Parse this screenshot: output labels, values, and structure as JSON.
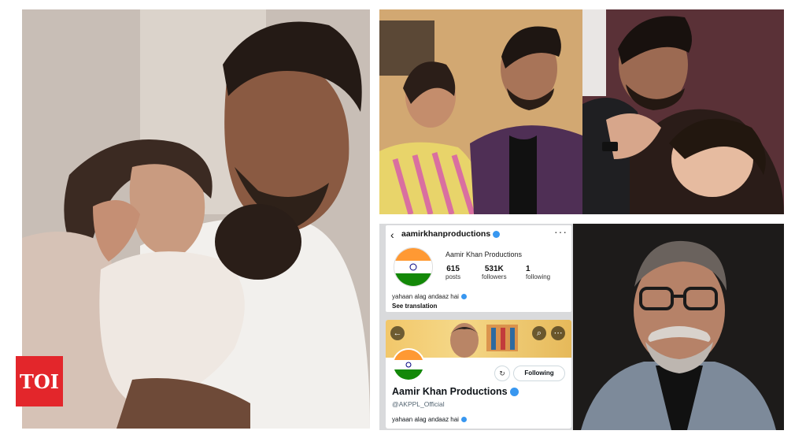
{
  "logo": {
    "text": "TOI"
  },
  "instagram": {
    "handle": "aamirkhanproductions",
    "more": "···",
    "display_name": "Aamir Khan Productions",
    "posts_count": "615",
    "posts_label": "posts",
    "followers_count": "531K",
    "followers_label": "followers",
    "following_count": "1",
    "following_label": "following",
    "bio": "yahaan alag andaaz hai",
    "see_translation": "See translation"
  },
  "twitter": {
    "follow_button": "Following",
    "display_name": "Aamir Khan Productions",
    "handle": "@AKPPL_Official",
    "bio": "yahaan alag andaaz hai"
  },
  "colors": {
    "toi_red": "#e3262b",
    "verified_blue": "#3897f0",
    "flag_saffron": "#ff9933",
    "flag_green": "#138808"
  },
  "icons": [
    "back-arrow-icon",
    "more-options-icon",
    "verified-badge-icon",
    "search-icon",
    "share-icon",
    "notification-icon",
    "india-flag-icon"
  ]
}
